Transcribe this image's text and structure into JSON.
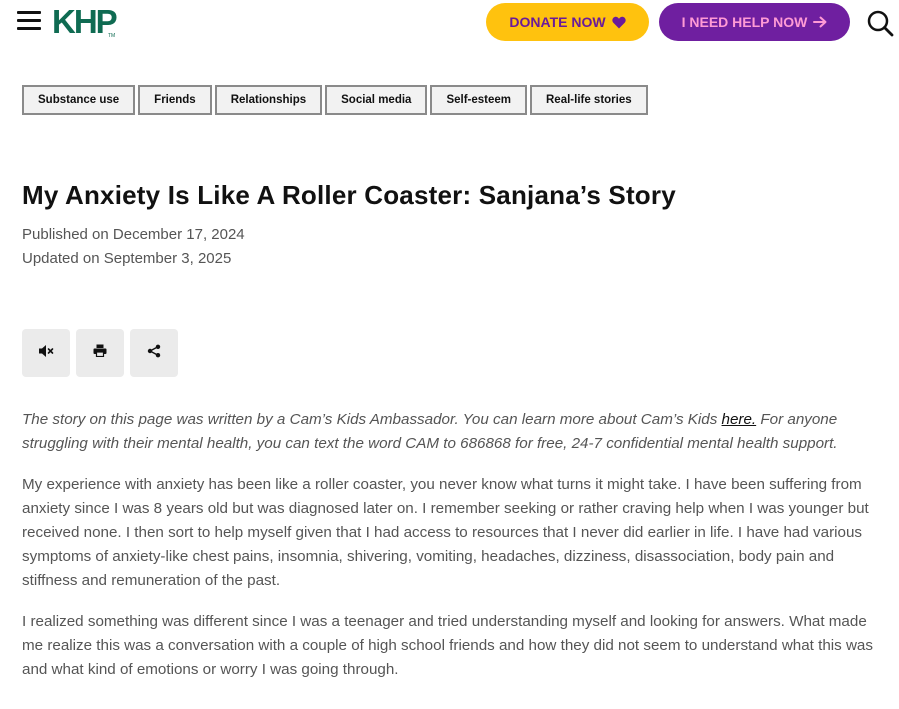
{
  "header": {
    "logo_text": "KHP",
    "logo_tm": "TM",
    "donate_label": "DONATE NOW",
    "help_label": "I NEED HELP NOW",
    "brand_green": "#0f6b52",
    "donate_bg": "#ffc20e",
    "help_bg": "#6f1fa0"
  },
  "tags": [
    "Substance use",
    "Friends",
    "Relationships",
    "Social media",
    "Self-esteem",
    "Real-life stories"
  ],
  "article": {
    "title": "My Anxiety Is Like A Roller Coaster: Sanjana’s Story",
    "published": "Published on December 17, 2024",
    "updated": "Updated on September 3, 2025",
    "intro_before": "The story on this page was written by a Cam’s Kids Ambassador. You can learn more about Cam’s Kids ",
    "intro_link": "here.",
    "intro_after": " For anyone struggling with their mental health, you can text the word CAM to 686868 for free, 24-7 confidential mental health support.",
    "paragraphs": [
      "My experience with anxiety has been like a roller coaster, you never know what turns it might take. I have been suffering from anxiety since I was 8 years old but was diagnosed later on. I remember seeking or rather craving help when I was younger but received none. I then sort to help myself given that I had access to resources that I never did earlier in life. I have had various symptoms of anxiety-like chest pains, insomnia, shivering, vomiting, headaches, dizziness, disassociation, body pain and stiffness and remuneration of the past.",
      "I realized something was different since I was a teenager and tried understanding myself and looking for answers. What made me realize this was a conversation with a couple of high school friends and how they did not seem to understand what this was and what kind of emotions or worry I was going through."
    ]
  },
  "tools": [
    {
      "icon": "speaker-muted-icon"
    },
    {
      "icon": "print-icon"
    },
    {
      "icon": "share-icon"
    }
  ]
}
